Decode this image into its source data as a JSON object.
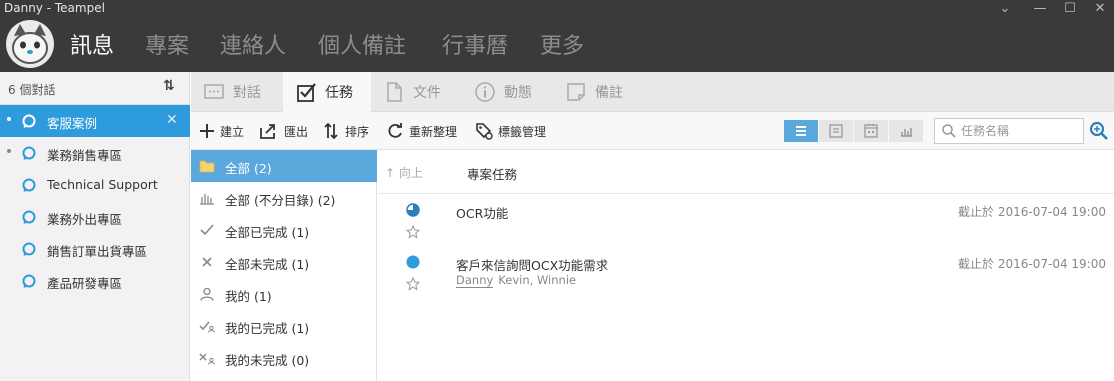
{
  "window": {
    "title": "Danny - Teampel"
  },
  "nav": {
    "items": [
      "訊息",
      "專案",
      "連絡人",
      "個人備註",
      "行事曆",
      "更多"
    ],
    "active_index": 0
  },
  "sidebar": {
    "count_label": "6 個對話",
    "items": [
      {
        "label": "客服案例",
        "dot": true,
        "selected": true
      },
      {
        "label": "業務銷售專區",
        "dot": true,
        "selected": false
      },
      {
        "label": "Technical Support",
        "dot": false,
        "selected": false
      },
      {
        "label": "業務外出專區",
        "dot": false,
        "selected": false
      },
      {
        "label": "銷售訂單出貨專區",
        "dot": false,
        "selected": false
      },
      {
        "label": "產品研發專區",
        "dot": false,
        "selected": false
      }
    ]
  },
  "tabs": [
    {
      "label": "對話",
      "icon": "chat-bubble-icon"
    },
    {
      "label": "任務",
      "icon": "checklist-icon",
      "active": true
    },
    {
      "label": "文件",
      "icon": "document-icon"
    },
    {
      "label": "動態",
      "icon": "info-icon"
    },
    {
      "label": "備註",
      "icon": "note-icon"
    }
  ],
  "toolbar": {
    "create": "建立",
    "export": "匯出",
    "sort": "排序",
    "reorganize": "重新整理",
    "tag_manage": "標籤管理",
    "search_placeholder": "任務名稱",
    "view_modes": [
      "list-view-icon",
      "card-view-icon",
      "calendar-view-icon",
      "chart-view-icon"
    ],
    "active_view_index": 0
  },
  "filters": [
    {
      "label": "全部 (2)",
      "icon": "folder-icon",
      "selected": true
    },
    {
      "label": "全部 (不分目錄) (2)",
      "icon": "bar-chart-icon"
    },
    {
      "label": "全部已完成 (1)",
      "icon": "check-icon"
    },
    {
      "label": "全部未完成 (1)",
      "icon": "x-icon"
    },
    {
      "label": "我的 (1)",
      "icon": "person-icon"
    },
    {
      "label": "我的已完成 (1)",
      "icon": "check-person-icon"
    },
    {
      "label": "我的未完成 (0)",
      "icon": "x-person-icon"
    }
  ],
  "list": {
    "up_label": "↑ 向上",
    "project_label": "專案任務",
    "tasks": [
      {
        "name": "OCR功能",
        "due": "截止於 2016-07-04 19:00",
        "progress": 0.25,
        "owner": "",
        "others": ""
      },
      {
        "name": "客戶來信詢問OCX功能需求",
        "due": "截止於 2016-07-04 19:00",
        "progress": 0,
        "owner": "Danny",
        "others": "Kevin, Winnie"
      }
    ]
  },
  "colors": {
    "accent": "#2e9bdc",
    "titlebar": "#3a3a3a",
    "selected_filter": "#5ba9dc"
  }
}
